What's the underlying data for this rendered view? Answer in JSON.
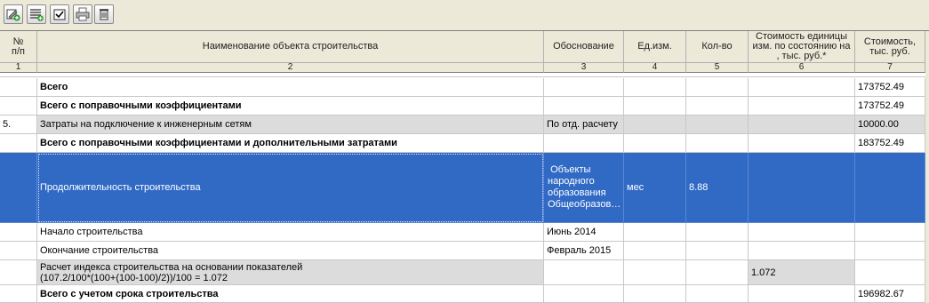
{
  "toolbar": {
    "buttons": [
      {
        "icon": "edit-add-icon"
      },
      {
        "icon": "list-add-icon"
      },
      {
        "icon": "checkbox-icon"
      },
      {
        "icon": "print-icon"
      },
      {
        "icon": "trash-icon"
      }
    ]
  },
  "columns": {
    "headers": [
      "№\nп/п",
      "Наименование объекта строительства",
      "Обоснование",
      "Ед.изм.",
      "Кол-во",
      "Стоимость единицы изм. по состоянию на , тыс. руб.*",
      "Стоимость, тыс. руб."
    ],
    "numbers": [
      "1",
      "2",
      "3",
      "4",
      "5",
      "6",
      "7"
    ]
  },
  "rows": [
    {
      "id": "",
      "name": "Всего",
      "basis": "",
      "unit": "",
      "qty": "",
      "unit_cost": "",
      "cost": "173752.49",
      "bold": true
    },
    {
      "id": "",
      "name": "Всего с поправочными коэффициентами",
      "basis": "",
      "unit": "",
      "qty": "",
      "unit_cost": "",
      "cost": "173752.49",
      "bold": true
    },
    {
      "id": "5.",
      "name": "Затраты на подключение к инженерным сетям",
      "basis": "По отд. расчету",
      "unit": "",
      "qty": "",
      "unit_cost": "",
      "cost": "10000.00",
      "bold": false
    },
    {
      "id": "",
      "name": "Всего с поправочными коэффициентами и дополнительными затратами",
      "basis": "",
      "unit": "",
      "qty": "",
      "unit_cost": "",
      "cost": "183752.49",
      "bold": true
    },
    {
      "id": "",
      "name": "Продолжительность строительства",
      "basis": " Объекты народного образования Общеобразов…",
      "unit": "мес",
      "qty": "8.88",
      "unit_cost": "",
      "cost": "",
      "bold": false
    },
    {
      "id": "",
      "name": "Начало строительства",
      "basis": "Июнь 2014",
      "unit": "",
      "qty": "",
      "unit_cost": "",
      "cost": "",
      "bold": false
    },
    {
      "id": "",
      "name": "Окончание строительства",
      "basis": "Февраль 2015",
      "unit": "",
      "qty": "",
      "unit_cost": "",
      "cost": "",
      "bold": false
    },
    {
      "id": "",
      "name": "Расчет индекса строительства на основании показателей\n(107.2/100*(100+(100-100)/2))/100 = 1.072",
      "basis": "",
      "unit": "",
      "qty": "",
      "unit_cost": "1.072",
      "cost": "",
      "bold": false
    },
    {
      "id": "",
      "name": "Всего с учетом срока строительства",
      "basis": "",
      "unit": "",
      "qty": "",
      "unit_cost": "",
      "cost": "196982.67",
      "bold": true
    }
  ],
  "colors": {
    "selection": "#316ac5",
    "header_bg": "#ece9d8",
    "gray_row": "#dcdcdc"
  }
}
